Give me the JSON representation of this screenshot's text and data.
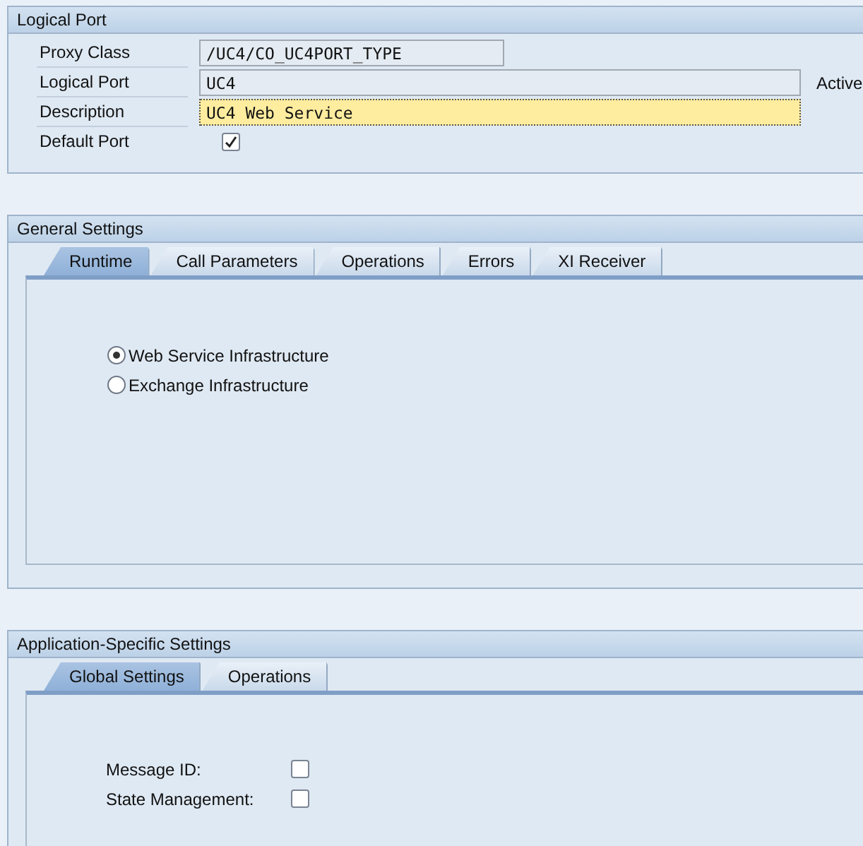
{
  "logical_port": {
    "title": "Logical Port",
    "fields": [
      {
        "label": "Proxy Class",
        "kind": "short",
        "value": "/UC4/CO_UC4PORT_TYPE",
        "focused": false
      },
      {
        "label": "Logical Port",
        "kind": "long",
        "value": "UC4",
        "focused": false,
        "status": "Active"
      },
      {
        "label": "Description",
        "kind": "long",
        "value": "UC4 Web Service",
        "focused": true
      },
      {
        "label": "Default Port",
        "kind": "checkbox",
        "checked": true
      }
    ]
  },
  "general_settings": {
    "title": "General Settings",
    "tabs": [
      {
        "label": "Runtime",
        "selected": true
      },
      {
        "label": "Call Parameters",
        "selected": false
      },
      {
        "label": "Operations",
        "selected": false
      },
      {
        "label": "Errors",
        "selected": false
      },
      {
        "label": "XI Receiver",
        "selected": false
      }
    ],
    "radios": [
      {
        "label": "Web Service Infrastructure",
        "selected": true
      },
      {
        "label": "Exchange Infrastructure",
        "selected": false
      }
    ]
  },
  "application_settings": {
    "title": "Application-Specific Settings",
    "tabs": [
      {
        "label": "Global Settings",
        "selected": true
      },
      {
        "label": "Operations",
        "selected": false
      }
    ],
    "checkboxes": [
      {
        "label": "Message ID:",
        "checked": false
      },
      {
        "label": "State Management:",
        "checked": false
      }
    ]
  }
}
